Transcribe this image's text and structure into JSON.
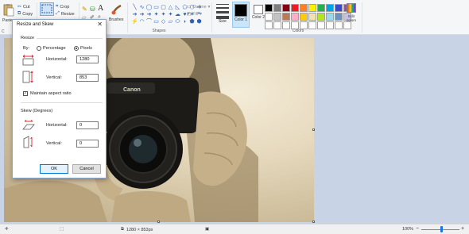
{
  "ribbon": {
    "clipboard": {
      "paste_label": "Paste",
      "cut_label": "Cut",
      "copy_label": "Copy",
      "group_label": "C"
    },
    "image": {
      "crop_label": "Crop",
      "resize_label": "Resize"
    },
    "tools": {
      "text_tool_glyph": "A"
    },
    "brushes_label": "Brushes",
    "shapes": {
      "outline_label": "Outline",
      "fill_label": "Fill",
      "group_label": "Shapes"
    },
    "size_label": "Size",
    "color1_label": "Color 1",
    "color2_label": "Color 2",
    "colors_group_label": "Colors",
    "edit_colors_label": "Edit colors",
    "color1_value": "#000000",
    "color2_value": "#ffffff",
    "palette_row1": [
      "#000000",
      "#7f7f7f",
      "#880015",
      "#ed1c24",
      "#ff7f27",
      "#fff200",
      "#22b14c",
      "#00a2e8",
      "#3f48cc",
      "#a349a4"
    ],
    "palette_row2": [
      "#ffffff",
      "#c3c3c3",
      "#b97a57",
      "#ffaec9",
      "#ffc90e",
      "#efe4b0",
      "#b5e61d",
      "#99d9ea",
      "#7092be",
      "#c8bfe7"
    ],
    "palette_row3": [
      "#ffffff",
      "#ffffff",
      "#ffffff",
      "#ffffff",
      "#ffffff",
      "#ffffff",
      "#ffffff",
      "#ffffff",
      "#ffffff",
      "#ffffff"
    ],
    "shape_glyphs": [
      "╲",
      "∿",
      "◯",
      "▭",
      "▢",
      "△",
      "◺",
      "⬠",
      "⬡",
      "➔",
      "➔",
      "➔",
      "➔",
      "✦",
      "✦",
      "✦",
      "☁",
      "♥",
      "✶",
      "❝",
      "⚡",
      "◠",
      "⌒",
      "▭",
      "◇",
      "▱",
      "⬭",
      "◗",
      "⬟",
      "⬢"
    ]
  },
  "dialog": {
    "title": "Resize and Skew",
    "resize_section": "Resize",
    "by_label": "By:",
    "percentage_label": "Percentage",
    "pixels_label": "Pixels",
    "horizontal_label": "Horizontal:",
    "vertical_label": "Vertical:",
    "resize_horizontal": "1280",
    "resize_vertical": "853",
    "maintain_label": "Maintain aspect ratio",
    "skew_section": "Skew (Degrees)",
    "skew_horizontal_label": "Horizontal:",
    "skew_vertical_label": "Vertical:",
    "skew_horizontal": "0",
    "skew_vertical": "0",
    "ok_label": "OK",
    "cancel_label": "Cancel"
  },
  "status": {
    "image_size": "1280 × 853px",
    "zoom": "100%",
    "zoom_minus": "−",
    "zoom_plus": "+"
  }
}
